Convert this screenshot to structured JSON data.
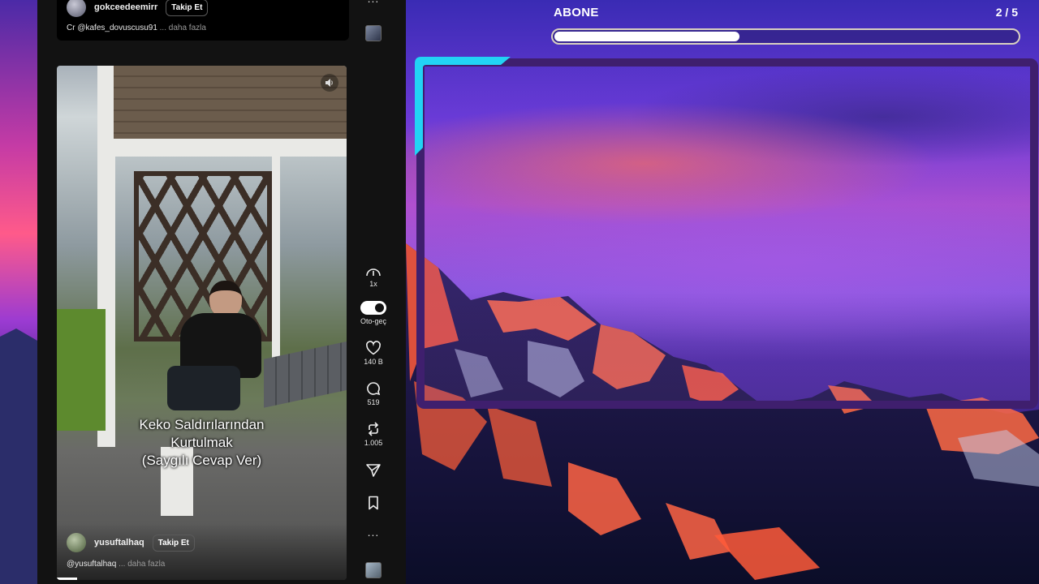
{
  "top_post": {
    "username": "gokceedeemirr",
    "follow_label": "Takip Et",
    "caption": "Cr @kafes_dovuscusu91",
    "more": "... daha fazla"
  },
  "video": {
    "overlay_line1": "Keko Saldırılarından",
    "overlay_line2": "Kurtulmak",
    "overlay_line3": "(Saygılı Cevap Ver)",
    "username": "yusuftalhaq",
    "follow_label": "Takip Et",
    "caption": "@yusuftalhaq",
    "more": "... daha fazla",
    "progress_fraction": 0.07
  },
  "rail": {
    "top_more": "...",
    "speed": "1x",
    "autoplay_label": "Oto-geç",
    "autoplay_on": true,
    "likes": "140 B",
    "comments": "519",
    "reposts": "1.005",
    "bottom_more": "..."
  },
  "widget": {
    "title": "ABONE",
    "count": "2 / 5",
    "progress_fraction": 0.4,
    "accent_color": "#22d3f5",
    "frame_color": "#3f1f6e"
  }
}
